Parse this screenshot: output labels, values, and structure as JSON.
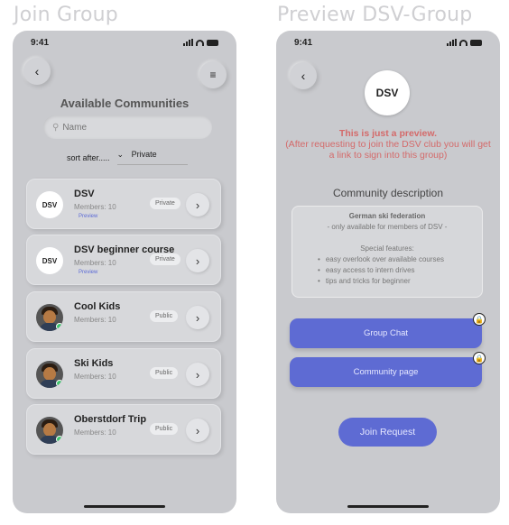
{
  "left_frame": {
    "title": "Join Group",
    "status_time": "9:41",
    "back_icon": "chevron-left-icon",
    "filter_icon": "filter-icon",
    "heading": "Available Communities",
    "search": {
      "placeholder": "Name",
      "icon": "search-icon"
    },
    "sort": {
      "label": "sort after.....",
      "value": "Private",
      "icon": "chevron-down-icon"
    },
    "communities": [
      {
        "name": "DSV",
        "members": "Members: 10",
        "preview": "Preview",
        "badge": "Private",
        "logo": "DSV"
      },
      {
        "name": "DSV beginner course",
        "members": "Members: 10",
        "preview": "Preview",
        "badge": "Private",
        "logo": "DSV"
      },
      {
        "name": "Cool Kids",
        "members": "Members: 10",
        "badge": "Public"
      },
      {
        "name": "Ski Kids",
        "members": "Members: 10",
        "badge": "Public"
      },
      {
        "name": "Oberstdorf Trip",
        "members": "Members: 10",
        "badge": "Public"
      }
    ]
  },
  "right_frame": {
    "title": "Preview DSV-Group",
    "status_time": "9:41",
    "back_icon": "chevron-left-icon",
    "logo": "DSV",
    "preview_heading": "This is just a preview.",
    "preview_text": "(After requesting to join the DSV club you will get a link to sign into this group)",
    "desc_title": "Community description",
    "description": {
      "federation": "German ski federation",
      "availability": "- only available for members of DSV -",
      "features_heading": "Special features:",
      "features": [
        "easy overlook over available courses",
        "easy access to intern drives",
        "tips and tricks for beginner"
      ]
    },
    "group_chat_label": "Group Chat",
    "community_page_label": "Community page",
    "join_label": "Join Request",
    "colors": {
      "accent": "#5e6bd3",
      "warning": "#d46a6a"
    }
  }
}
